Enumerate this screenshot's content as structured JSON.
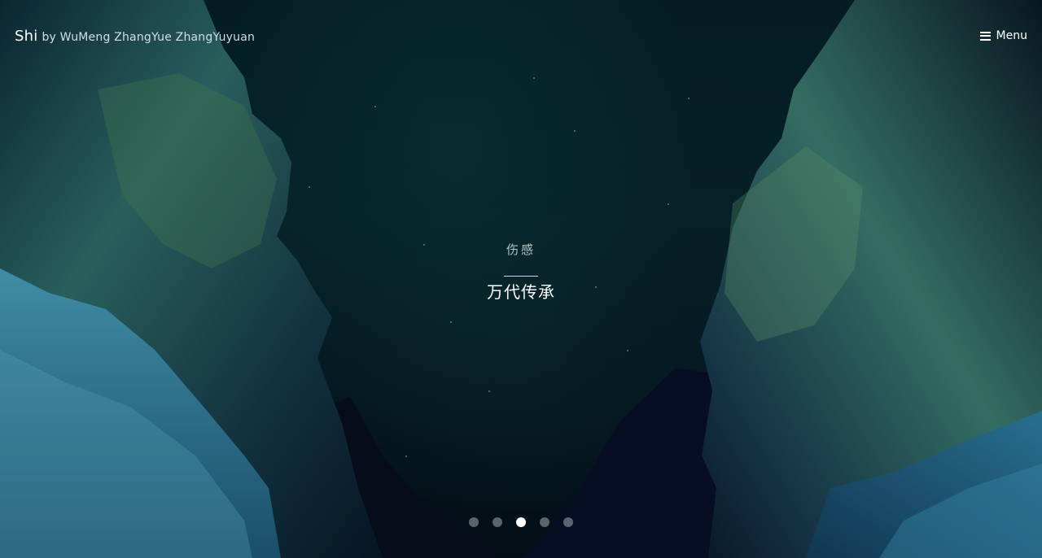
{
  "header": {
    "brand_name": "Shi",
    "brand_byline": "by WuMeng ZhangYue ZhangYuyuan",
    "menu_label": "Menu",
    "menu_icon": "hamburger-icon"
  },
  "hero": {
    "subtitle": "伤感",
    "title": "万代传承"
  },
  "slider": {
    "total_slides": 5,
    "active_slide": 3
  },
  "colors": {
    "sky": "#05222a",
    "cliff_highlight": "#3f8a86",
    "snow": "#3b8fb0",
    "text": "#ffffff"
  }
}
